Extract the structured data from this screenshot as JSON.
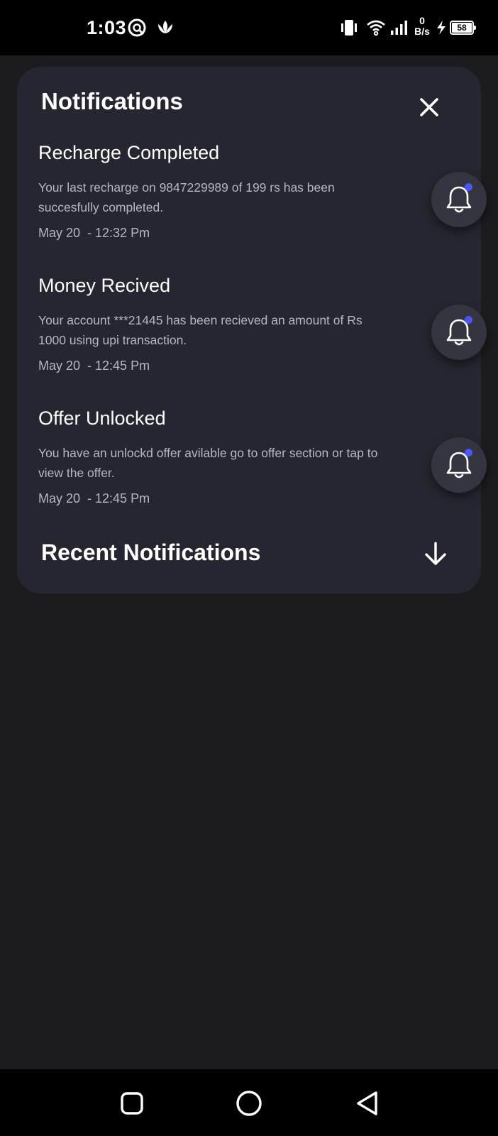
{
  "status_bar": {
    "time": "1:03",
    "net_speed_value": "0",
    "net_speed_unit": "B/s",
    "battery_level": "58"
  },
  "panel": {
    "title": "Notifications",
    "notifications": [
      {
        "title": "Recharge Completed",
        "body": "Your last recharge on 9847229989 of 199 rs has been succesfully completed.",
        "time": "May 20  - 12:32 Pm"
      },
      {
        "title": "Money Recived",
        "body": "Your account ***21445 has been recieved an amount of Rs 1000 using upi transaction.",
        "time": "May 20  - 12:45 Pm"
      },
      {
        "title": "Offer Unlocked",
        "body": "You have an unlockd offer avilable go to offer section or tap to view the offer.",
        "time": "May 20  - 12:45 Pm"
      }
    ],
    "recent_title": "Recent Notifications"
  },
  "colors": {
    "background": "#1b1b20",
    "panel": "#25262f",
    "bell_button": "#34353f",
    "unread_dot": "#4a56f5",
    "secondary_text": "#b6b7c0"
  },
  "icons": {
    "close": "close-icon",
    "bell": "bell-icon",
    "arrow_down": "arrow-down-icon",
    "nav_recent": "square-icon",
    "nav_home": "circle-icon",
    "nav_back": "triangle-back-icon"
  }
}
